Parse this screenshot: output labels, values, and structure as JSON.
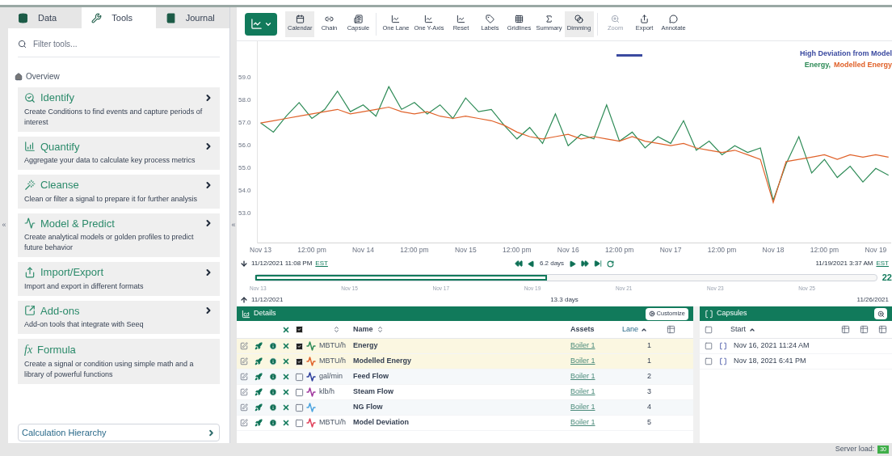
{
  "sidebar": {
    "collapse": "«",
    "tabs": [
      {
        "label": "Data",
        "selected": false
      },
      {
        "label": "Tools",
        "selected": true
      },
      {
        "label": "Journal",
        "selected": false
      }
    ],
    "filter": {
      "placeholder": "Filter tools..."
    },
    "overview": "Overview",
    "tools": [
      {
        "title": "Identify",
        "description": "Create Conditions to find events and capture periods of interest"
      },
      {
        "title": "Quantify",
        "description": "Aggregate your data to calculate key process metrics"
      },
      {
        "title": "Cleanse",
        "description": "Clean or filter a signal to prepare it for further analysis"
      },
      {
        "title": "Model & Predict",
        "description": "Create analytical models or golden profiles to predict future behavior"
      },
      {
        "title": "Import/Export",
        "description": "Import and export in different formats"
      },
      {
        "title": "Add-ons",
        "description": "Add-on tools that integrate with Seeq"
      },
      {
        "title": "Formula",
        "symbol": "fx",
        "description": "Create a signal or condition using simple math and a library of powerful functions"
      }
    ],
    "calculation_hierarchy": "Calculation Hierarchy"
  },
  "divider": {
    "collapse": "«"
  },
  "toolbar": {
    "items": [
      {
        "label": "Calendar",
        "active": true,
        "disabled": false
      },
      {
        "label": "Chain",
        "active": false,
        "disabled": false
      },
      {
        "label": "Capsule",
        "active": false,
        "disabled": false
      },
      {
        "label": "One Lane",
        "active": false,
        "disabled": false
      },
      {
        "label": "One Y-Axis",
        "active": false,
        "disabled": false
      },
      {
        "label": "Reset",
        "active": false,
        "disabled": false
      },
      {
        "label": "Labels",
        "active": false,
        "disabled": false
      },
      {
        "label": "Gridlines",
        "active": false,
        "disabled": false
      },
      {
        "label": "Summary",
        "active": false,
        "disabled": false
      },
      {
        "label": "Dimming",
        "active": true,
        "disabled": false
      },
      {
        "label": "Zoom",
        "active": false,
        "disabled": true
      },
      {
        "label": "Export",
        "active": false,
        "disabled": false
      },
      {
        "label": "Annotate",
        "active": false,
        "disabled": false
      }
    ]
  },
  "chart": {
    "legend": [
      {
        "text": "High Deviation from Model",
        "color": "#3b4aa0"
      }
    ],
    "legend_separator": ",",
    "chart_data": {
      "type": "line",
      "xlim": [
        "2021-11-12T23:08",
        "2021-11-19T03:37"
      ],
      "ylim": [
        51.7,
        60.6
      ],
      "x": [
        "2021-11-13T00:00",
        "2021-11-13T03:00",
        "2021-11-13T06:00",
        "2021-11-13T09:00",
        "2021-11-13T12:00",
        "2021-11-13T15:00",
        "2021-11-13T18:00",
        "2021-11-13T21:00",
        "2021-11-14T00:00",
        "2021-11-14T03:00",
        "2021-11-14T06:00",
        "2021-11-14T09:00",
        "2021-11-14T12:00",
        "2021-11-14T15:00",
        "2021-11-14T18:00",
        "2021-11-14T21:00",
        "2021-11-15T00:00",
        "2021-11-15T03:00",
        "2021-11-15T06:00",
        "2021-11-15T09:00",
        "2021-11-15T12:00",
        "2021-11-15T15:00",
        "2021-11-15T18:00",
        "2021-11-15T21:00",
        "2021-11-16T00:00",
        "2021-11-16T03:00",
        "2021-11-16T06:00",
        "2021-11-16T09:00",
        "2021-11-16T12:00",
        "2021-11-16T15:00",
        "2021-11-16T18:00",
        "2021-11-16T21:00",
        "2021-11-17T00:00",
        "2021-11-17T03:00",
        "2021-11-17T06:00",
        "2021-11-17T09:00",
        "2021-11-17T12:00",
        "2021-11-17T15:00",
        "2021-11-17T18:00",
        "2021-11-17T21:00",
        "2021-11-18T00:00",
        "2021-11-18T03:00",
        "2021-11-18T06:00",
        "2021-11-18T09:00",
        "2021-11-18T12:00",
        "2021-11-18T15:00",
        "2021-11-18T18:00",
        "2021-11-18T21:00",
        "2021-11-19T00:00",
        "2021-11-19T03:00"
      ],
      "series": [
        {
          "name": "Energy",
          "color": "#2e8b57",
          "values": [
            57.0,
            56.6,
            57.3,
            57.9,
            57.2,
            57.6,
            58.4,
            57.5,
            57.8,
            57.3,
            58.6,
            57.6,
            57.9,
            57.4,
            57.8,
            57.2,
            58.1,
            57.5,
            57.6,
            56.9,
            56.3,
            56.8,
            56.1,
            57.4,
            56.0,
            56.5,
            56.3,
            57.8,
            56.2,
            56.6,
            55.9,
            56.4,
            56.1,
            57.1,
            55.8,
            56.2,
            55.6,
            56.0,
            55.7,
            55.9,
            53.6,
            55.2,
            56.4,
            54.8,
            55.4,
            54.6,
            55.1,
            54.4,
            55.0,
            54.7
          ]
        },
        {
          "name": "Modelled Energy",
          "color": "#e0622a",
          "values": [
            57.0,
            57.1,
            57.2,
            57.3,
            57.4,
            57.5,
            57.6,
            57.4,
            57.5,
            57.6,
            57.7,
            57.5,
            57.4,
            57.5,
            57.3,
            57.2,
            57.3,
            57.2,
            57.1,
            56.9,
            56.6,
            56.4,
            56.3,
            56.4,
            56.5,
            56.3,
            56.4,
            56.3,
            56.2,
            56.4,
            56.2,
            56.1,
            56.0,
            56.1,
            55.9,
            55.8,
            55.7,
            55.8,
            55.6,
            55.4,
            53.5,
            55.3,
            55.4,
            55.5,
            55.6,
            55.4,
            55.6,
            55.5,
            55.6,
            55.5
          ]
        }
      ],
      "yticks": [
        {
          "value": 59,
          "label": "59.0"
        },
        {
          "value": 58,
          "label": "58.0"
        },
        {
          "value": 57,
          "label": "57.0"
        },
        {
          "value": 56,
          "label": "56.0"
        },
        {
          "value": 55,
          "label": "55.0"
        },
        {
          "value": 54,
          "label": "54.0"
        },
        {
          "value": 53,
          "label": "53.0"
        }
      ],
      "xticks": [
        {
          "value": "2021-11-13T00:00",
          "label": "Nov 13"
        },
        {
          "value": "2021-11-13T12:00",
          "label": "12:00 pm"
        },
        {
          "value": "2021-11-14T00:00",
          "label": "Nov 14"
        },
        {
          "value": "2021-11-14T12:00",
          "label": "12:00 pm"
        },
        {
          "value": "2021-11-15T00:00",
          "label": "Nov 15"
        },
        {
          "value": "2021-11-15T12:00",
          "label": "12:00 pm"
        },
        {
          "value": "2021-11-16T00:00",
          "label": "Nov 16"
        },
        {
          "value": "2021-11-16T12:00",
          "label": "12:00 pm"
        },
        {
          "value": "2021-11-17T00:00",
          "label": "Nov 17"
        },
        {
          "value": "2021-11-17T12:00",
          "label": "12:00 pm"
        },
        {
          "value": "2021-11-18T00:00",
          "label": "Nov 18"
        },
        {
          "value": "2021-11-18T12:00",
          "label": "12:00 pm"
        },
        {
          "value": "2021-11-19T00:00",
          "label": "Nov 19"
        }
      ]
    }
  },
  "range": {
    "start": "11/12/2021 11:08 PM",
    "start_zone": "EST",
    "duration": "6.2 days",
    "end": "11/19/2021 3:37 AM",
    "end_zone": "EST"
  },
  "overview": {
    "level": 0.47,
    "count": "22",
    "labels": [
      "Nov 13",
      "Nov 15",
      "Nov 17",
      "Nov 19",
      "Nov 21",
      "Nov 23",
      "Nov 25"
    ],
    "start": "11/12/2021",
    "duration": "13.3 days",
    "end": "11/26/2021"
  },
  "details": {
    "title": "Details",
    "customize": "Customize",
    "select_all_checked": true,
    "columns": {
      "name": "Name",
      "assets": "Assets",
      "lane": "Lane"
    },
    "rows": [
      {
        "unit": "MBTU/h",
        "name": "Energy",
        "asset": "Boiler 1",
        "lane": "1",
        "checked": true,
        "color": "#2e8b57"
      },
      {
        "unit": "MBTU/h",
        "name": "Modelled Energy",
        "asset": "Boiler 1",
        "lane": "1",
        "checked": true,
        "color": "#e0622a"
      },
      {
        "unit": "gal/min",
        "name": "Feed Flow",
        "asset": "Boiler 1",
        "lane": "2",
        "checked": false,
        "color": "#2c3e9c"
      },
      {
        "unit": "klb/h",
        "name": "Steam Flow",
        "asset": "Boiler 1",
        "lane": "3",
        "checked": false,
        "color": "#a0379e"
      },
      {
        "name": "NG Flow",
        "asset": "Boiler 1",
        "lane": "4",
        "checked": false,
        "color": "#4aa3df"
      },
      {
        "unit": "MBTU/h",
        "name": "Model Deviation",
        "asset": "Boiler 1",
        "lane": "5",
        "checked": false,
        "color": "#e0405a"
      }
    ]
  },
  "capsules": {
    "title": "Capsules",
    "start_column": "Start",
    "rows": [
      {
        "start": "Nov 16, 2021 11:24 AM",
        "checked": false
      },
      {
        "start": "Nov 18, 2021 6:41 PM",
        "checked": false
      }
    ]
  },
  "status": {
    "label": "Server load:",
    "badge": "30"
  }
}
